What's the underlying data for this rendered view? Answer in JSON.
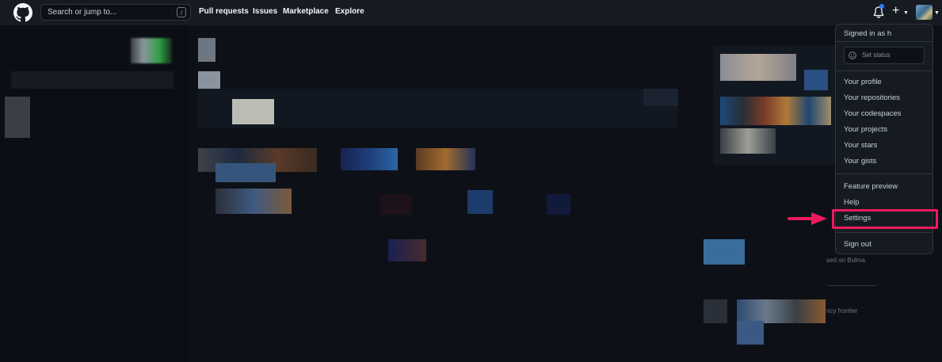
{
  "header": {
    "search_placeholder": "Search or jump to...",
    "search_shortcut": "/",
    "nav": [
      "Pull requests",
      "Issues",
      "Marketplace",
      "Explore"
    ]
  },
  "dropdown": {
    "signed_in": "Signed in as h",
    "set_status": "Set status",
    "group1": [
      "Your profile",
      "Your repositories",
      "Your codespaces",
      "Your projects",
      "Your stars",
      "Your gists"
    ],
    "group2": [
      "Feature preview",
      "Help",
      "Settings"
    ],
    "sign_out": "Sign out"
  },
  "background_text": {
    "bulma": "sed on Bulma",
    "frontier": "ncy frontier"
  },
  "colors": {
    "highlight": "#ef1a5d",
    "header_bg": "#161b22",
    "page_bg": "#0d1117"
  }
}
